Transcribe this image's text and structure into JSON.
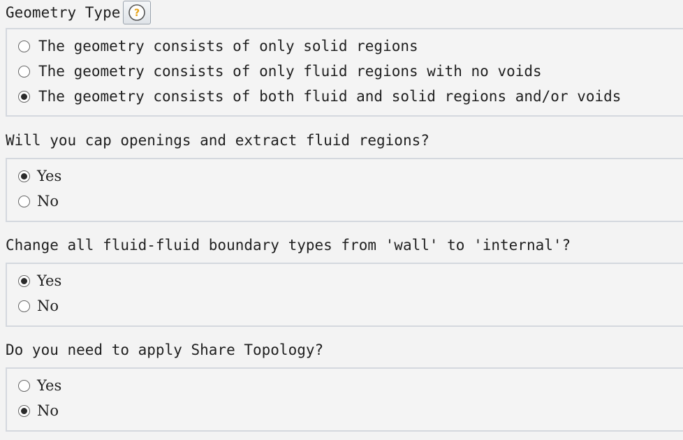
{
  "geometry_type": {
    "title": "Geometry Type",
    "help_icon": "question-mark-circle-icon",
    "help_color": "#e8a317",
    "options": [
      {
        "label": "The geometry consists of only solid regions",
        "selected": false
      },
      {
        "label": "The geometry consists of only fluid regions with no voids",
        "selected": false
      },
      {
        "label": "The geometry consists of both fluid and solid regions and/or voids",
        "selected": true
      }
    ]
  },
  "cap_openings": {
    "question": "Will you cap openings and extract fluid regions?",
    "options": [
      {
        "label": "Yes",
        "selected": true
      },
      {
        "label": "No",
        "selected": false
      }
    ]
  },
  "change_boundary": {
    "question": "Change all fluid-fluid boundary types from 'wall' to 'internal'?",
    "options": [
      {
        "label": "Yes",
        "selected": true
      },
      {
        "label": "No",
        "selected": false
      }
    ]
  },
  "share_topology": {
    "question": "Do you need to apply Share Topology?",
    "options": [
      {
        "label": "Yes",
        "selected": false
      },
      {
        "label": "No",
        "selected": true
      }
    ]
  }
}
